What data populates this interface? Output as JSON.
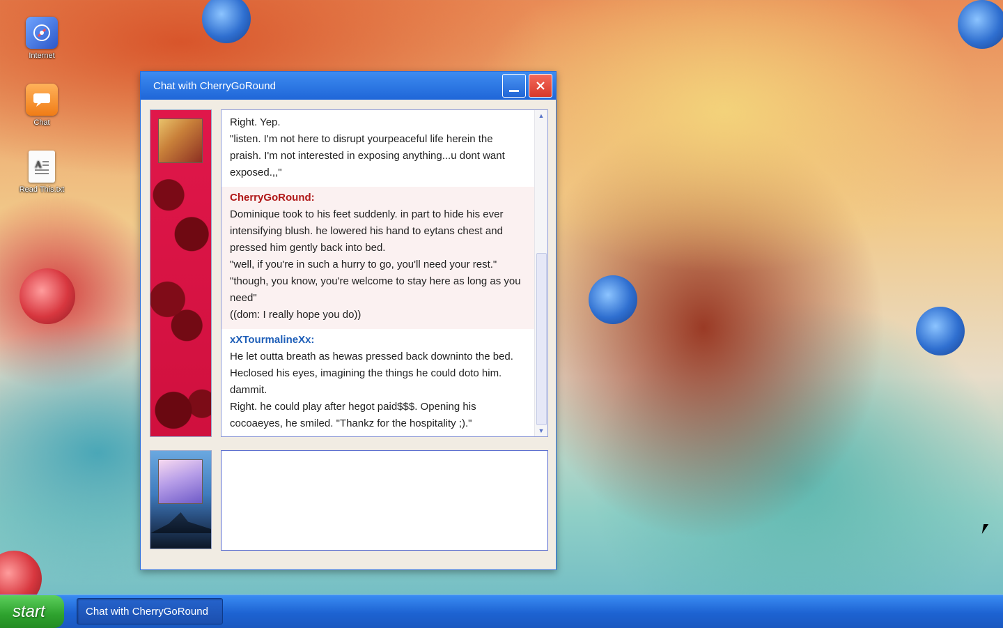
{
  "desktop": {
    "icons": [
      {
        "label": "Internet",
        "icon": "globe-icon"
      },
      {
        "label": "Chat",
        "icon": "chat-bubble-icon"
      },
      {
        "label": "Read This.txt",
        "icon": "text-file-icon"
      }
    ]
  },
  "chat_window": {
    "title": "Chat with CherryGoRound",
    "minimize_icon": "minimize-icon",
    "close_icon": "close-icon",
    "compose_placeholder": "",
    "messages": [
      {
        "from": "",
        "color": "#222222",
        "lines": [
          "Right. Yep.",
          "\"listen. I'm not here to disrupt yourpeaceful life herein the praish. I'm not interested in exposing anything...u dont want exposed.,,\""
        ]
      },
      {
        "from": "CherryGoRound:",
        "color": "#b01818",
        "lines": [
          "Dominique took to his feet suddenly. in part to hide his ever intensifying blush. he lowered his hand to eytans chest and pressed him gently back into bed.",
          "\"well, if you're in such a hurry to go, you'll need your rest.\"",
          "\"though, you know, you're welcome to stay here as long as you need\"",
          "((dom: I really hope you do))"
        ]
      },
      {
        "from": "xXTourmalineXx:",
        "color": "#1f5fb8",
        "lines": [
          "He let outta breath as hewas pressed back downinto the bed. Heclosed his eyes, imagining the things he could doto him. dammit.",
          "Right. he could play after hegot paid$$$. Opening his cocoaeyes, he smiled. \"Thankz for the hospitality ;).\""
        ]
      }
    ]
  },
  "taskbar": {
    "start_label": "start",
    "task_button_label": "Chat with CherryGoRound"
  },
  "colors": {
    "titlebar": "#1f66d8",
    "close_button": "#d8392a",
    "start_green": "#2ea22e"
  }
}
